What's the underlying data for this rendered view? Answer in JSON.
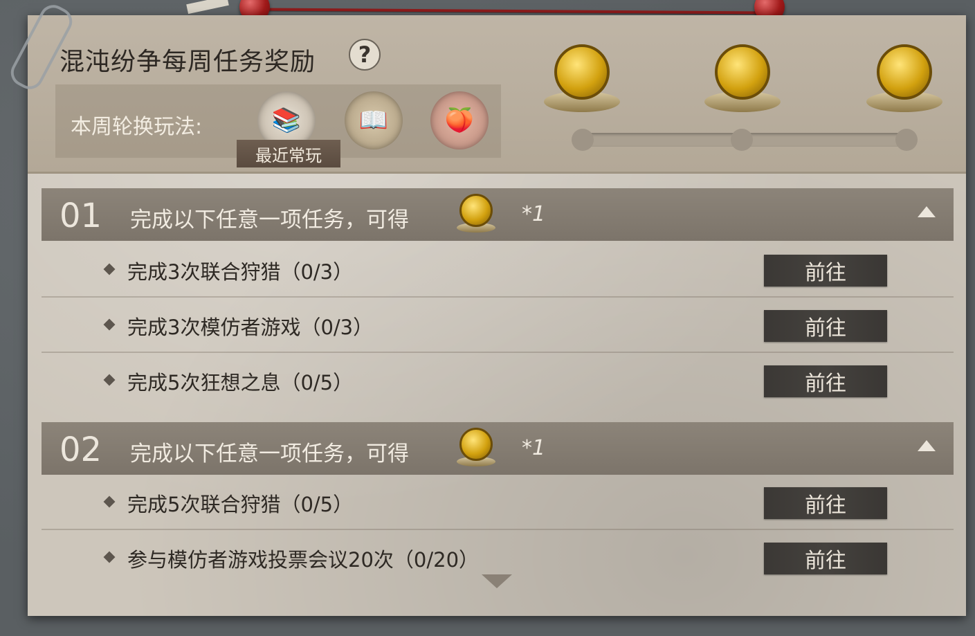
{
  "header": {
    "title": "混沌纷争每周任务奖励",
    "help_label": "?",
    "modes_label": "本周轮换玩法:",
    "modes": [
      {
        "name": "mode-icon-books",
        "recent": true
      },
      {
        "name": "mode-icon-book",
        "recent": false
      },
      {
        "name": "mode-icon-peach",
        "recent": false
      }
    ],
    "recent_tag": "最近常玩",
    "milestone_progress": 0
  },
  "groups": [
    {
      "number": "01",
      "text": "完成以下任意一项任务，可得",
      "reward_multiplier": "*1",
      "tasks": [
        {
          "text": "完成3次联合狩猎（0/3）",
          "button": "前往"
        },
        {
          "text": "完成3次模仿者游戏（0/3）",
          "button": "前往"
        },
        {
          "text": "完成5次狂想之息（0/5）",
          "button": "前往"
        }
      ]
    },
    {
      "number": "02",
      "text": "完成以下任意一项任务，可得",
      "reward_multiplier": "*1",
      "tasks": [
        {
          "text": "完成5次联合狩猎（0/5）",
          "button": "前往"
        },
        {
          "text": "参与模仿者游戏投票会议20次（0/20）",
          "button": "前往"
        }
      ]
    }
  ],
  "colors": {
    "paper": "#cdc6bb",
    "group_header": "#847c71",
    "button_bg": "#3f3c38",
    "medal_gold": "#d2a10f"
  }
}
